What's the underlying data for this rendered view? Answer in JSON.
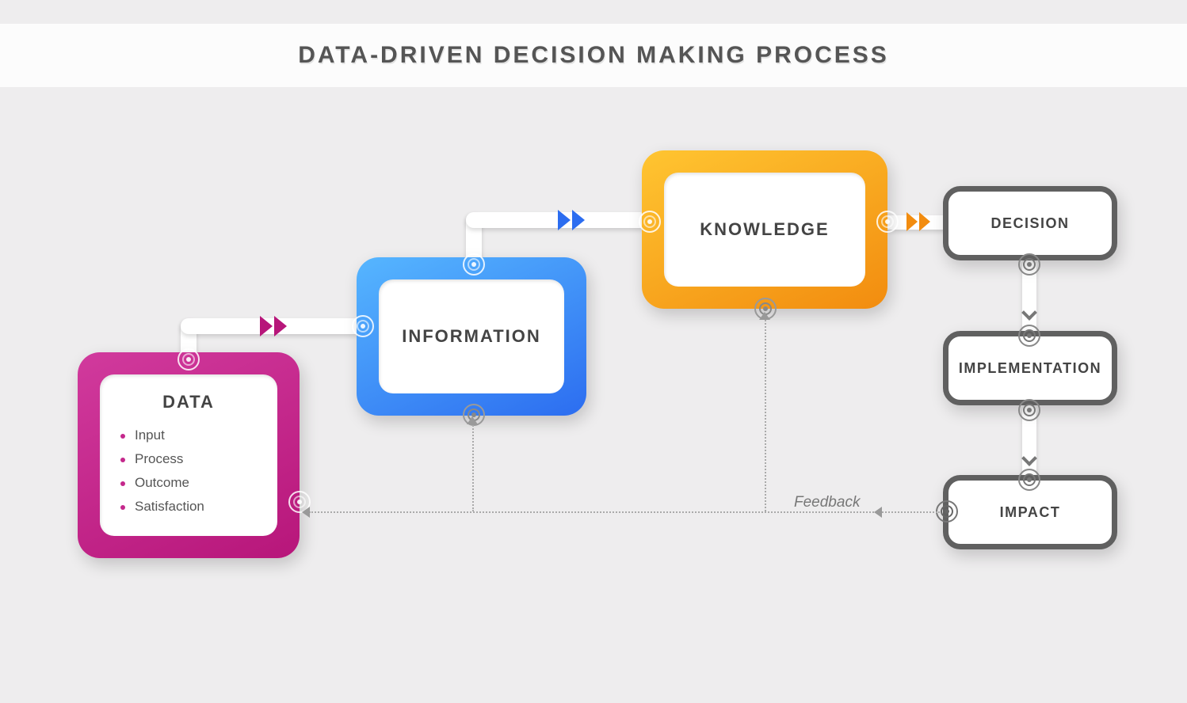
{
  "title": "DATA-DRIVEN DECISION MAKING PROCESS",
  "nodes": {
    "data": {
      "label": "DATA",
      "items": [
        "Input",
        "Process",
        "Outcome",
        "Satisfaction"
      ],
      "color": "#b7167a"
    },
    "information": {
      "label": "INFORMATION",
      "color": "#2c6df0"
    },
    "knowledge": {
      "label": "KNOWLEDGE",
      "color": "#f28c0f"
    },
    "decision": {
      "label": "DECISION"
    },
    "implementation": {
      "label": "IMPLEMENTATION"
    },
    "impact": {
      "label": "IMPACT"
    }
  },
  "feedback_label": "Feedback"
}
